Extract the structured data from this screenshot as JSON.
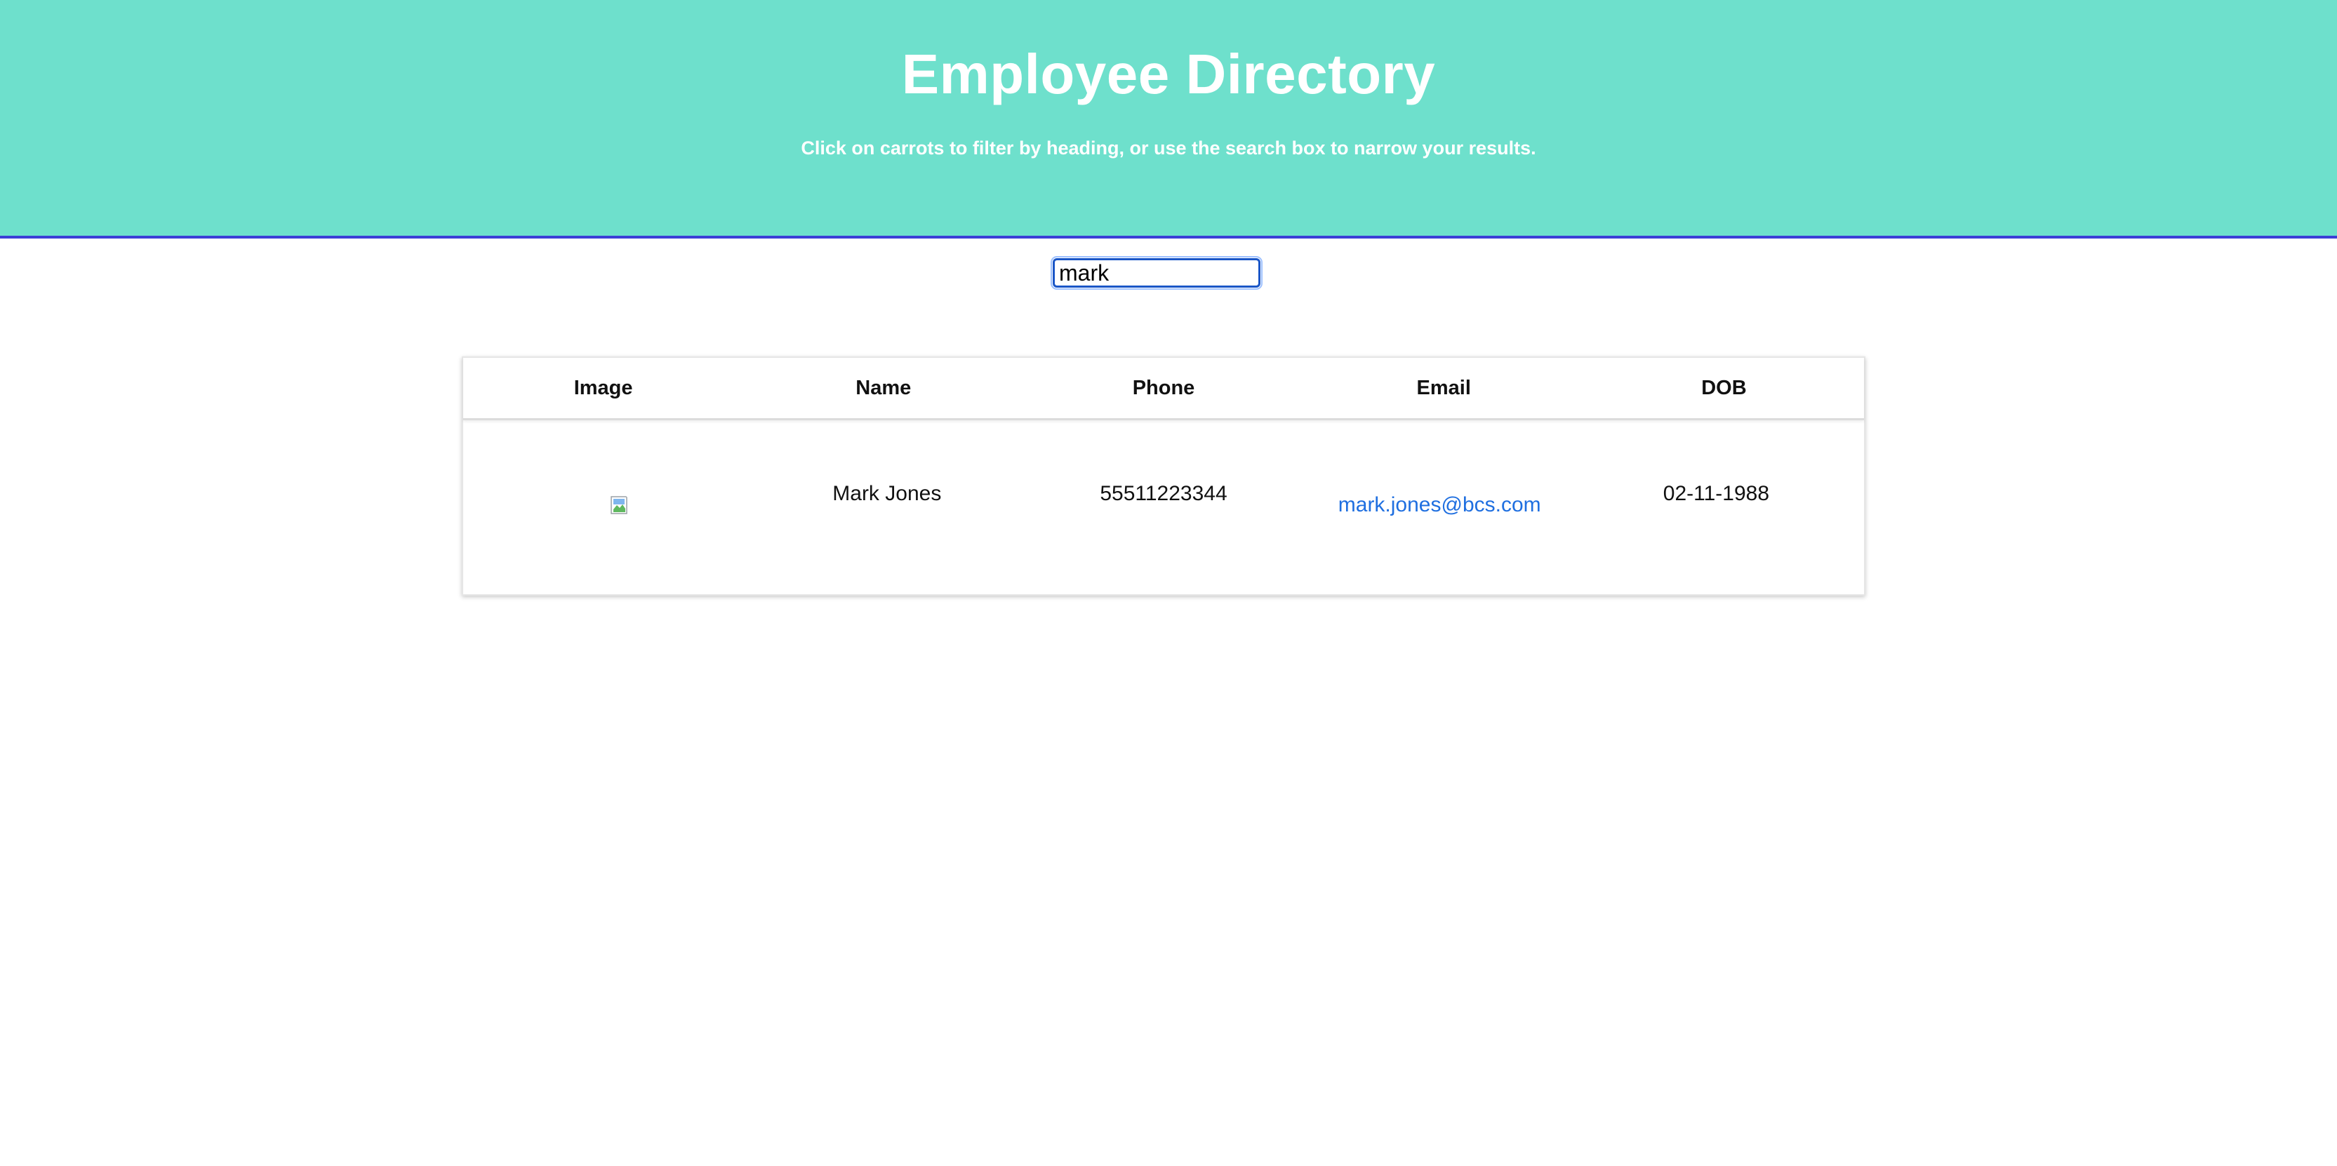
{
  "header": {
    "title": "Employee Directory",
    "subtitle": "Click on carrots to filter by heading, or use the search box to narrow your results."
  },
  "search": {
    "value": "mark",
    "placeholder": ""
  },
  "table": {
    "columns": [
      "Image",
      "Name",
      "Phone",
      "Email",
      "DOB"
    ],
    "rows": [
      {
        "image": "broken-image-icon",
        "name": "Mark Jones",
        "phone": "55511223344",
        "email": "mark.jones@bcs.com",
        "dob": "02-11-1988"
      }
    ]
  },
  "colors": {
    "header_bg": "#6ee0cc",
    "header_border": "#3c3fd6",
    "link": "#1f6fe0",
    "input_border": "#1a56c7"
  }
}
